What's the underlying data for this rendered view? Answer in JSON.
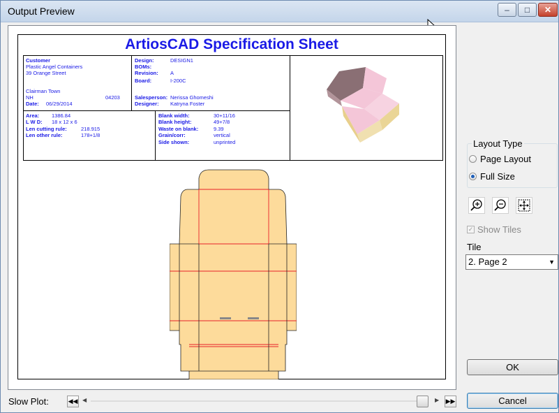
{
  "window": {
    "title": "Output Preview",
    "controls": {
      "minimize": "–",
      "maximize": "□",
      "close": "✕"
    }
  },
  "sheet": {
    "title": "ArtiosCAD Specification Sheet",
    "customer": {
      "label": "Customer",
      "name": "Plastic Angel Containers",
      "street": "39 Orange Street",
      "town": "Clairman Town",
      "state": "NH",
      "zip": "04203",
      "date_label": "Date:",
      "date": "06/29/2014"
    },
    "design_block": {
      "design_label": "Design:",
      "design": "DESIGN1",
      "bom_label": "BOMs:",
      "bom": "",
      "revision_label": "Revision:",
      "revision": "A",
      "board_label": "Board:",
      "board": "I-200C",
      "salesperson_label": "Salesperson:",
      "salesperson": "Nerissa Ghomeshi",
      "designer_label": "Designer:",
      "designer": "Katryna Foster"
    },
    "dims_left": {
      "area_label": "Area:",
      "area": "1386.84",
      "lwd_label": "L W D:",
      "lwd": "18 x 12 x 6",
      "cutting_label": "Len cutting rule:",
      "cutting": "218.915",
      "other_label": "Len other rule:",
      "other": "178+1/8"
    },
    "dims_right": {
      "blank_width_label": "Blank width:",
      "blank_width": "30+11/16",
      "blank_height_label": "Blank height:",
      "blank_height": "49+7/8",
      "waste_label": "Waste on blank:",
      "waste": "9.39",
      "grain_label": "Grain/corr:",
      "grain": "vertical",
      "side_label": "Side shown:",
      "side": "unprinted"
    },
    "colors": {
      "text": "#1a1ae6",
      "board": "#fddb9b",
      "crease": "#e8202a",
      "box_pink": "#f4c6d8",
      "box_shade": "#8a6f74"
    }
  },
  "sidebar": {
    "layout_type": {
      "title": "Layout Type",
      "options": [
        {
          "label": "Page Layout",
          "selected": false
        },
        {
          "label": "Full Size",
          "selected": true
        }
      ]
    },
    "zoom_buttons": [
      "zoom-in-icon",
      "zoom-out-icon",
      "zoom-fit-icon"
    ],
    "show_tiles": {
      "label": "Show Tiles",
      "checked": true,
      "disabled": true
    },
    "tile": {
      "label": "Tile",
      "value": "2. Page 2"
    },
    "ok_label": "OK",
    "cancel_label": "Cancel"
  },
  "footer": {
    "slow_plot_label": "Slow Plot:"
  }
}
